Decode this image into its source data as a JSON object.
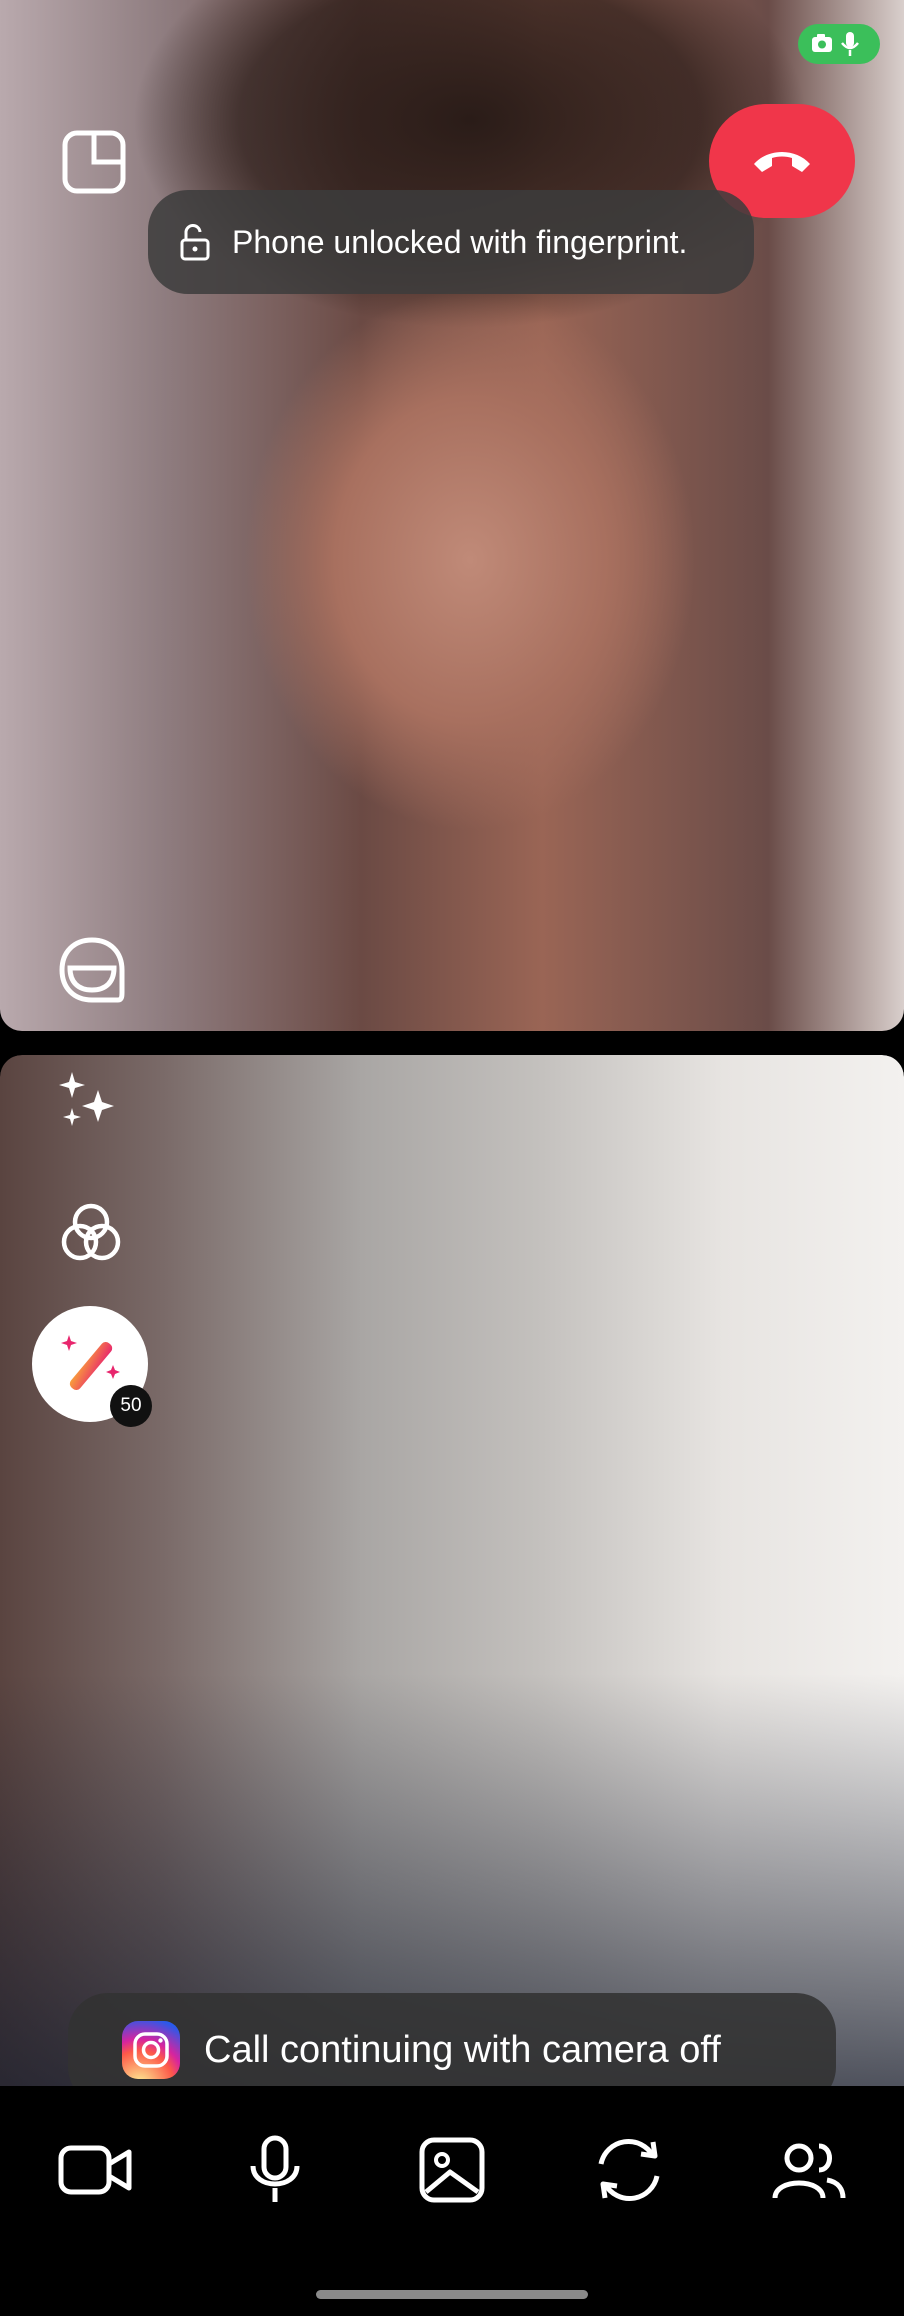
{
  "status_bar": {
    "indicator_icons": [
      "camera-icon",
      "microphone-icon"
    ],
    "indicator_color": "#3bbf5a"
  },
  "remote_view": {
    "icons": [
      "pip-icon",
      "sticker-icon"
    ]
  },
  "end_call": {
    "color": "#f0364a",
    "icon": "hang-up-icon"
  },
  "fingerprint_toast": {
    "text": "Phone unlocked with fingerprint.",
    "icon": "unlock-icon"
  },
  "local_view": {
    "side_tools": [
      "sparkles-icon",
      "filters-icon",
      "magic-wand-icon"
    ],
    "effects_badge": "50"
  },
  "camera_toast": {
    "text": "Call continuing with camera off",
    "icon": "instagram-icon"
  },
  "bottom_bar": {
    "buttons": [
      "video-camera-icon",
      "microphone-icon",
      "media-image-icon",
      "flip-camera-icon",
      "participants-icon"
    ]
  }
}
